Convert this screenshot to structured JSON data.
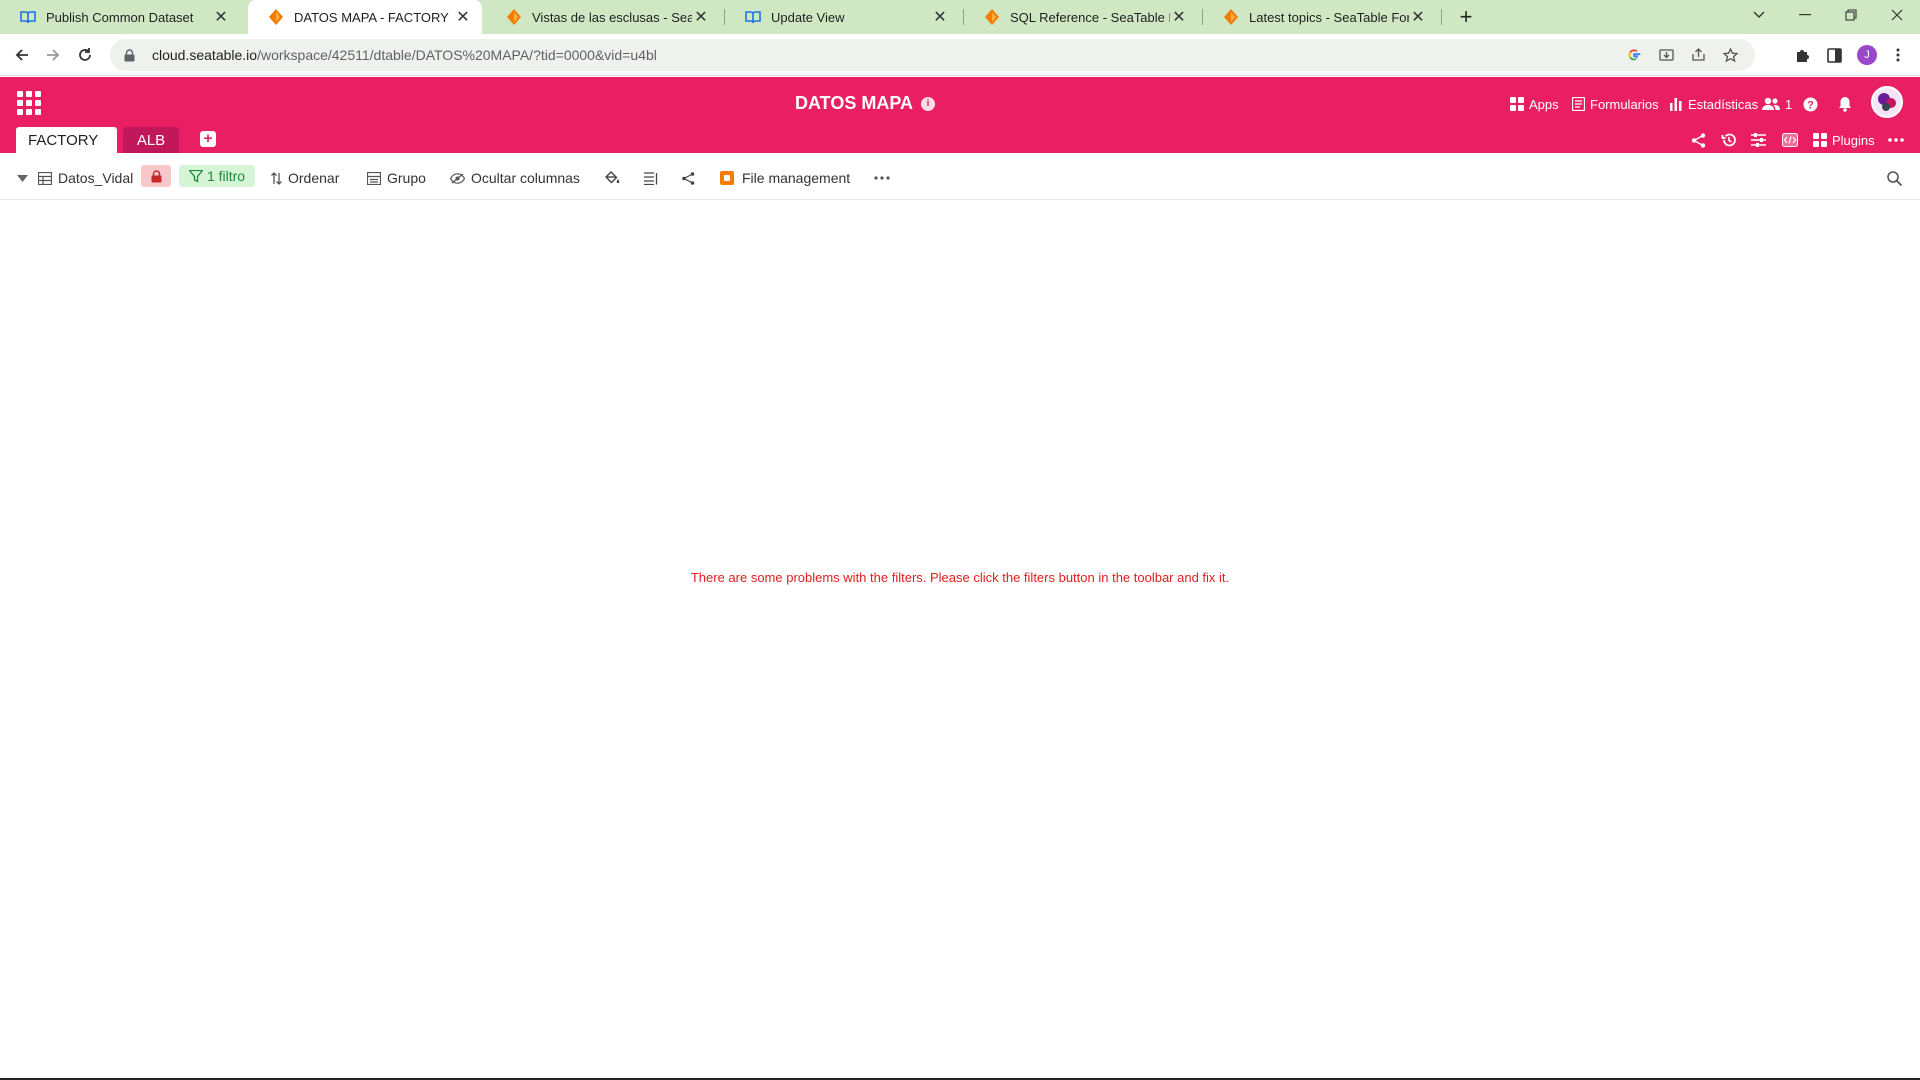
{
  "browser": {
    "tabs": [
      {
        "title": "Publish Common Dataset",
        "favicon": "book-icon",
        "active": false
      },
      {
        "title": "DATOS MAPA - FACTORY",
        "favicon": "seatable-icon",
        "active": true
      },
      {
        "title": "Vistas de las esclusas - SeaTable",
        "favicon": "seatable-icon",
        "active": false
      },
      {
        "title": "Update View",
        "favicon": "book-icon",
        "active": false
      },
      {
        "title": "SQL Reference - SeaTable Programmer",
        "favicon": "seatable-icon",
        "active": false
      },
      {
        "title": "Latest topics - SeaTable Forum",
        "favicon": "seatable-icon",
        "active": false
      }
    ],
    "url_host": "cloud.seatable.io",
    "url_path": "/workspace/42511/dtable/DATOS%20MAPA/?tid=0000&vid=u4bl",
    "profile_initial": "J"
  },
  "app": {
    "base_title": "DATOS MAPA",
    "header_links": {
      "apps": "Apps",
      "forms": "Formularios",
      "stats": "Estadísticas",
      "collaborators_count": "1"
    },
    "tables": [
      {
        "name": "FACTORY",
        "active": true
      },
      {
        "name": "ALB",
        "active": false
      }
    ],
    "plugins_label": "Plugins",
    "accent": "#e91e63"
  },
  "toolbar": {
    "view_name": "Datos_Vidal",
    "filter_label": "1 filtro",
    "sort_label": "Ordenar",
    "group_label": "Grupo",
    "hide_columns_label": "Ocultar columnas",
    "file_management_label": "File management"
  },
  "content": {
    "error_message": "There are some problems with the filters. Please click the filters button in the toolbar and fix it."
  }
}
